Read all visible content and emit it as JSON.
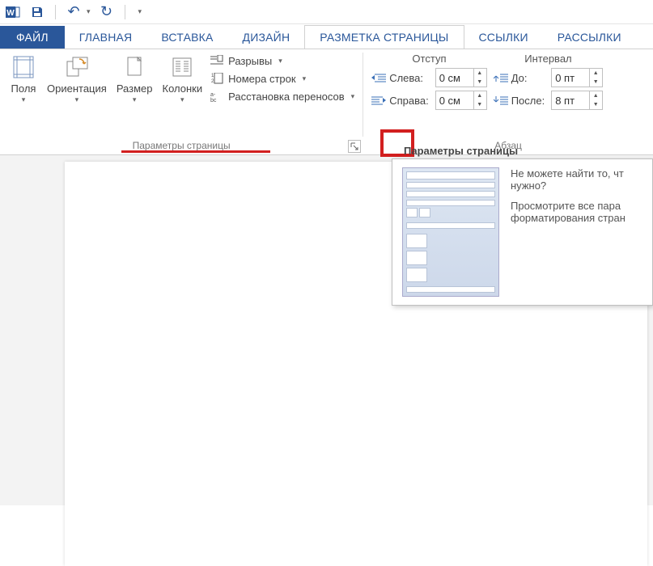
{
  "qat": {
    "undo": "↶",
    "redo": "↻"
  },
  "tabs": {
    "file": "ФАЙЛ",
    "home": "ГЛАВНАЯ",
    "insert": "ВСТАВКА",
    "design": "ДИЗАЙН",
    "layout": "РАЗМЕТКА СТРАНИЦЫ",
    "references": "ССЫЛКИ",
    "mailings": "РАССЫЛКИ"
  },
  "pagegroup": {
    "title": "Параметры страницы",
    "margins": "Поля",
    "orientation": "Ориентация",
    "size": "Размер",
    "columns": "Колонки",
    "breaks": "Разрывы",
    "linenum": "Номера строк",
    "hyphen": "Расстановка переносов"
  },
  "paragroup": {
    "title": "Абзац",
    "indent_h": "Отступ",
    "spacing_h": "Интервал",
    "left": "Слева:",
    "right": "Справа:",
    "before": "До:",
    "after": "После:",
    "left_v": "0 см",
    "right_v": "0 см",
    "before_v": "0 пт",
    "after_v": "8 пт"
  },
  "tooltip": {
    "title": "Параметры страницы",
    "l1": "Не можете найти то, чт",
    "l2": "нужно?",
    "l3": "Просмотрите все пара",
    "l4": "форматирования стран"
  }
}
